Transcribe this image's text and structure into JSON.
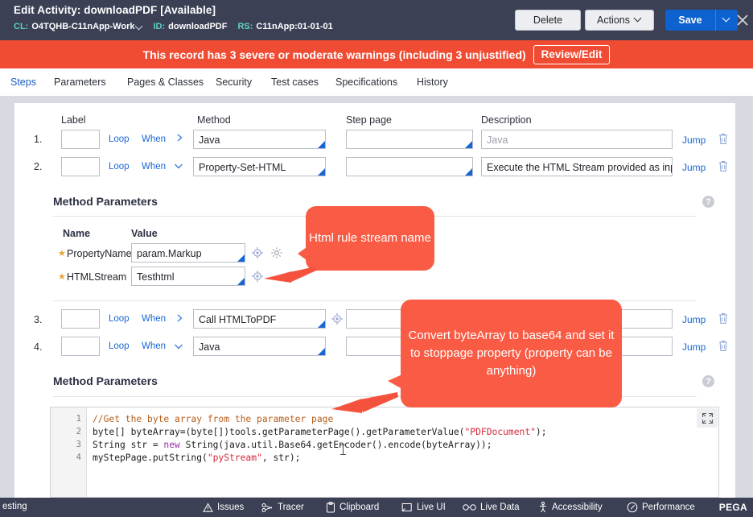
{
  "header": {
    "title": "Edit Activity: downloadPDF [Available]",
    "meta": [
      {
        "label": "CL:",
        "value": "O4TQHB-C11nApp-Work",
        "has_caret": true
      },
      {
        "label": "ID:",
        "value": "downloadPDF",
        "has_caret": false
      },
      {
        "label": "RS:",
        "value": "C11nApp:01-01-01",
        "has_caret": false
      }
    ],
    "buttons": {
      "delete": "Delete",
      "actions": "Actions",
      "save": "Save",
      "save_dropdown_icon": "chevron-down-icon",
      "close_icon": "close-icon"
    }
  },
  "warning": {
    "message": "This record has 3 severe or moderate warnings (including 3 unjustified)",
    "button": "Review/Edit",
    "color": "#f04b33"
  },
  "tabs": [
    {
      "label": "Steps",
      "active": true
    },
    {
      "label": "Parameters",
      "active": false
    },
    {
      "label": "Pages & Classes",
      "active": false
    },
    {
      "label": "Security",
      "active": false
    },
    {
      "label": "Test cases",
      "active": false
    },
    {
      "label": "Specifications",
      "active": false
    },
    {
      "label": "History",
      "active": false
    }
  ],
  "steps_table": {
    "columns": [
      "Label",
      "Method",
      "Step page",
      "Description"
    ],
    "loop_label": "Loop",
    "when_label": "When",
    "jump_label": "Jump",
    "rows": [
      {
        "number": "1.",
        "label": "",
        "expanded": false,
        "method": "Java",
        "step_page": "",
        "description": "Java",
        "description_is_placeholder": true,
        "has_config_icon": false
      },
      {
        "number": "2.",
        "label": "",
        "expanded": true,
        "method": "Property-Set-HTML",
        "step_page": "",
        "description": "Execute the HTML Stream provided as inpu",
        "description_is_placeholder": false,
        "has_config_icon": false
      },
      {
        "number": "3.",
        "label": "",
        "expanded": false,
        "method": "Call HTMLToPDF",
        "step_page": "",
        "description": "",
        "description_is_placeholder": false,
        "has_config_icon": true
      },
      {
        "number": "4.",
        "label": "",
        "expanded": true,
        "method": "Java",
        "step_page": "",
        "description": "",
        "description_is_placeholder": false,
        "has_config_icon": false
      }
    ]
  },
  "method_parameters_1": {
    "title": "Method Parameters",
    "help_icon": "help-icon",
    "columns": [
      "Name",
      "Value"
    ],
    "rows": [
      {
        "required": true,
        "name": "PropertyName",
        "value": "param.Markup",
        "icons": [
          "target-icon",
          "gear-icon"
        ]
      },
      {
        "required": true,
        "name": "HTMLStream",
        "value": "Testhtml",
        "icons": [
          "target-icon"
        ]
      }
    ]
  },
  "method_parameters_2": {
    "title": "Method Parameters",
    "help_icon": "help-icon"
  },
  "code_editor": {
    "expand_icon": "expand-icon",
    "lines": [
      {
        "num": "1",
        "tokens": [
          {
            "t": "//Get the byte array from the parameter page",
            "c": "comment"
          }
        ]
      },
      {
        "num": "2",
        "tokens": [
          {
            "t": "byte[] byteArray=(byte[])tools.getParameterPage().getParameterValue(",
            "c": "plain"
          },
          {
            "t": "\"PDFDocument\"",
            "c": "str"
          },
          {
            "t": ");",
            "c": "plain"
          }
        ]
      },
      {
        "num": "3",
        "tokens": [
          {
            "t": "String str = ",
            "c": "plain"
          },
          {
            "t": "new",
            "c": "kw"
          },
          {
            "t": " String(java.util.Base64.getEncoder().encode(byteArray));",
            "c": "plain"
          }
        ]
      },
      {
        "num": "4",
        "tokens": [
          {
            "t": "myStepPage.putString(",
            "c": "plain"
          },
          {
            "t": "\"pyStream\"",
            "c": "str"
          },
          {
            "t": ", str);",
            "c": "plain"
          }
        ]
      }
    ]
  },
  "callouts": [
    {
      "text": "Html rule stream name",
      "color": "#f95b44"
    },
    {
      "text": "Convert byteArray to base64 and set it to stoppage property (property can be anything)",
      "color": "#f95b44"
    }
  ],
  "status_bar": {
    "left_text": "esting",
    "items": [
      {
        "label": "Issues",
        "icon": "warning-triangle-icon"
      },
      {
        "label": "Tracer",
        "icon": "tracer-icon"
      },
      {
        "label": "Clipboard",
        "icon": "clipboard-icon"
      },
      {
        "label": "Live UI",
        "icon": "live-ui-icon"
      },
      {
        "label": "Live Data",
        "icon": "binoculars-icon"
      },
      {
        "label": "Accessibility",
        "icon": "accessibility-icon"
      },
      {
        "label": "Performance",
        "icon": "performance-icon"
      }
    ],
    "logo": "PEGA"
  }
}
